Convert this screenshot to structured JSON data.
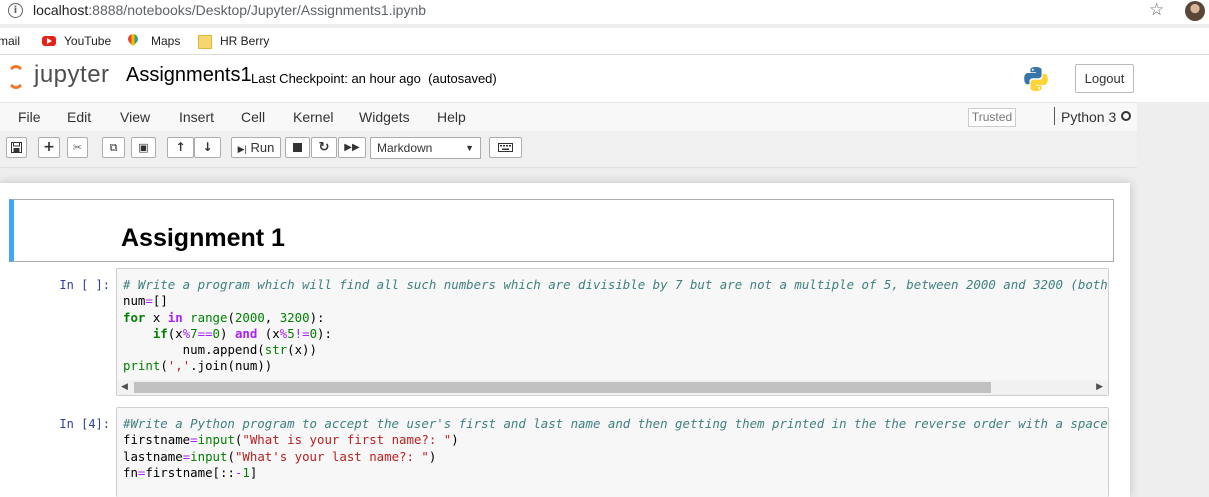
{
  "browser": {
    "url_host": "localhost",
    "url_path": ":8888/notebooks/Desktop/Jupyter/Assignments1.ipynb",
    "bookmarks": [
      {
        "label": "mail",
        "icon": "gmail-icon"
      },
      {
        "label": "YouTube",
        "icon": "youtube-icon"
      },
      {
        "label": "Maps",
        "icon": "maps-pin-icon"
      },
      {
        "label": "HR Berry",
        "icon": "folder-icon"
      }
    ]
  },
  "header": {
    "logo_text": "jupyter",
    "notebook_title": "Assignments1",
    "checkpoint": "Last Checkpoint: an hour ago",
    "autosave": "(autosaved)",
    "logout_label": "Logout"
  },
  "menubar": {
    "items": [
      "File",
      "Edit",
      "View",
      "Insert",
      "Cell",
      "Kernel",
      "Widgets",
      "Help"
    ],
    "trusted_label": "Trusted",
    "kernel_name": "Python 3"
  },
  "toolbar": {
    "run_label": "Run",
    "cell_type": "Markdown"
  },
  "cells": {
    "markdown_heading": "Assignment 1",
    "cell1_prompt": "In [ ]:",
    "cell2_prompt": "In [4]:"
  },
  "colors": {
    "jupyter_orange": "#f37726",
    "selected_cell_border": "#42a5f5",
    "prompt_blue": "#303f9f"
  }
}
